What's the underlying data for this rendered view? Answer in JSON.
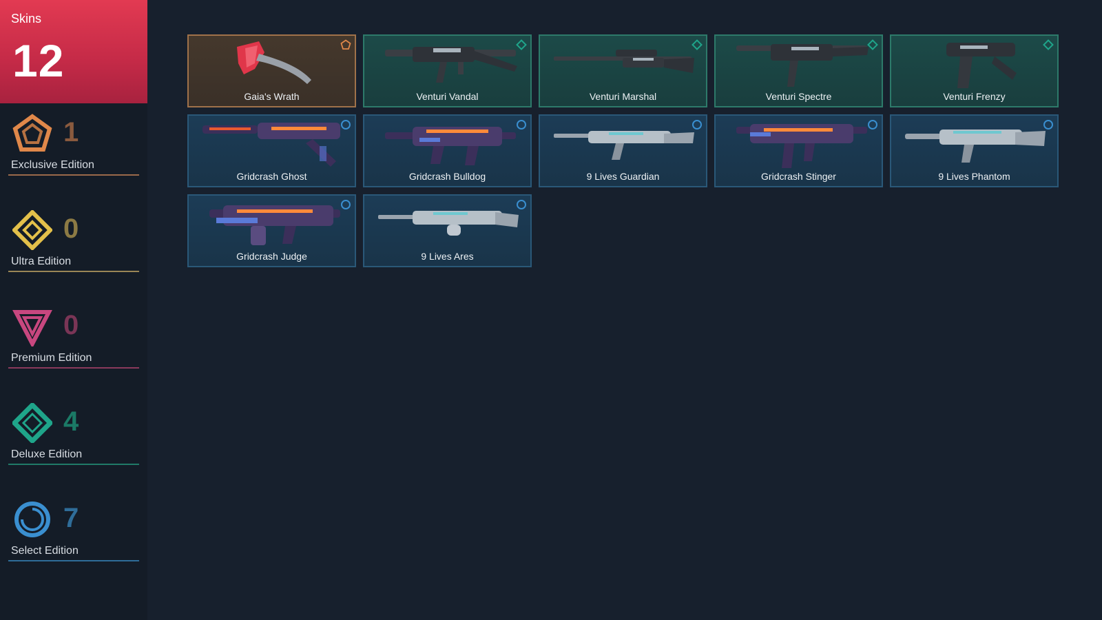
{
  "sidebar": {
    "skins_label": "Skins",
    "skins_count": "12",
    "header_color": "#e23a52",
    "tiers": [
      {
        "name": "Exclusive Edition",
        "count": "1",
        "color": "#e0884a",
        "icon": "exclusive-pentagon-icon"
      },
      {
        "name": "Ultra Edition",
        "count": "0",
        "color": "#e3c04a",
        "icon": "ultra-diamond-icon"
      },
      {
        "name": "Premium Edition",
        "count": "0",
        "color": "#c8477f",
        "icon": "premium-triangle-icon"
      },
      {
        "name": "Deluxe Edition",
        "count": "4",
        "color": "#1fa58a",
        "icon": "deluxe-rhombus-icon"
      },
      {
        "name": "Select Edition",
        "count": "7",
        "color": "#3a8fd0",
        "icon": "select-circle-icon"
      }
    ]
  },
  "skins": [
    {
      "name": "Gaia's Wrath",
      "tier": "exclusive",
      "weapon": "melee-axe-icon"
    },
    {
      "name": "Venturi Vandal",
      "tier": "deluxe",
      "weapon": "rifle-icon"
    },
    {
      "name": "Venturi Marshal",
      "tier": "deluxe",
      "weapon": "sniper-icon"
    },
    {
      "name": "Venturi Spectre",
      "tier": "deluxe",
      "weapon": "smg-icon"
    },
    {
      "name": "Venturi Frenzy",
      "tier": "deluxe",
      "weapon": "pistol-icon"
    },
    {
      "name": "Gridcrash Ghost",
      "tier": "select",
      "weapon": "pistol-icon"
    },
    {
      "name": "Gridcrash Bulldog",
      "tier": "select",
      "weapon": "rifle-icon"
    },
    {
      "name": "9 Lives Guardian",
      "tier": "select",
      "weapon": "rifle-icon"
    },
    {
      "name": "Gridcrash Stinger",
      "tier": "select",
      "weapon": "smg-icon"
    },
    {
      "name": "9 Lives Phantom",
      "tier": "select",
      "weapon": "rifle-icon"
    },
    {
      "name": "Gridcrash Judge",
      "tier": "select",
      "weapon": "shotgun-icon"
    },
    {
      "name": "9 Lives Ares",
      "tier": "select",
      "weapon": "lmg-icon"
    }
  ]
}
